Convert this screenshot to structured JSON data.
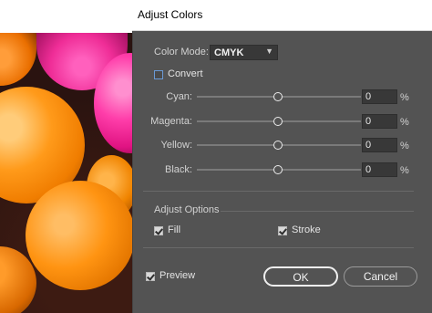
{
  "dialog": {
    "title": "Adjust Colors",
    "color_mode": {
      "label": "Color Mode:",
      "value": "CMYK"
    },
    "convert": {
      "label": "Convert",
      "checked": false
    },
    "channels": [
      {
        "label": "Cyan:",
        "value": "0",
        "unit": "%",
        "level_percent": 0
      },
      {
        "label": "Magenta:",
        "value": "0",
        "unit": "%",
        "level_percent": 0
      },
      {
        "label": "Yellow:",
        "value": "0",
        "unit": "%",
        "level_percent": 0
      },
      {
        "label": "Black:",
        "value": "0",
        "unit": "%",
        "level_percent": 0
      }
    ],
    "adjust_options": {
      "heading": "Adjust Options",
      "fill": {
        "label": "Fill",
        "checked": true
      },
      "stroke": {
        "label": "Stroke",
        "checked": true
      }
    },
    "preview": {
      "label": "Preview",
      "checked": true
    },
    "ok_label": "OK",
    "cancel_label": "Cancel"
  },
  "colors": {
    "dialog_bg": "#535353",
    "field_bg": "#383838",
    "focus_border": "#efefef",
    "checkbox_accent": "#6a9ad6"
  },
  "icons": {
    "dropdown": "chevron-down-icon",
    "check": "checkmark-icon"
  }
}
